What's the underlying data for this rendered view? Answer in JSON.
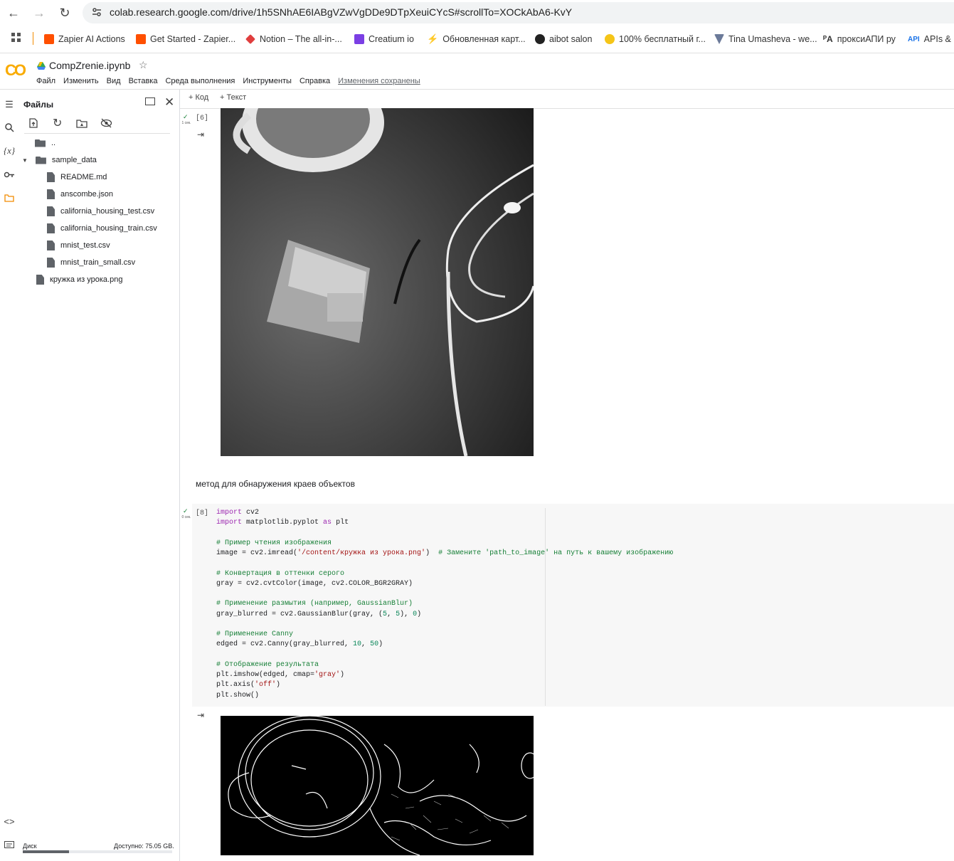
{
  "browser": {
    "url": "colab.research.google.com/drive/1h5SNhAE6IABgVZwVgDDe9DTpXeuiCYcS#scrollTo=XOCkAbA6-KvY",
    "bookmarks": [
      {
        "label": "Zapier AI Actions",
        "color": "#ff4f00"
      },
      {
        "label": "Get Started - Zapier...",
        "color": "#ff4f00"
      },
      {
        "label": "Notion – The all-in-...",
        "color": "#e03e3e"
      },
      {
        "label": "Creatium io",
        "color": "#7b3fe4"
      },
      {
        "label": "Обновленная карт...",
        "color": "#4b3fe4"
      },
      {
        "label": "aibot salon",
        "color": "#222222"
      },
      {
        "label": "100% бесплатный г...",
        "color": "#f5c518"
      },
      {
        "label": "Tina Umasheva - we...",
        "color": "#6b7a99"
      },
      {
        "label": "проксиАПИ ру",
        "color": "#333333"
      },
      {
        "label": "APIs & S",
        "color": "#1a73e8"
      }
    ]
  },
  "header": {
    "title": "CompZrenie.ipynb",
    "logo": "CO",
    "menu": [
      "Файл",
      "Изменить",
      "Вид",
      "Вставка",
      "Среда выполнения",
      "Инструменты",
      "Справка",
      "Изменения сохранены"
    ]
  },
  "sidebar": {
    "title": "Файлы",
    "parent": "..",
    "folder": "sample_data",
    "files": [
      "README.md",
      "anscombe.json",
      "california_housing_test.csv",
      "california_housing_train.csv",
      "mnist_test.csv",
      "mnist_train_small.csv"
    ],
    "root_file": "кружка из урока.png",
    "disk_label": "Диск",
    "disk_available": "Доступно: 75.05 GB.",
    "disk_used_fraction": 0.31
  },
  "toolbar": {
    "add_code": "Код",
    "add_text": "Текст"
  },
  "cells": {
    "cell1_count": "[6]",
    "cell1_time": "1 сек.",
    "text_cell": "метод для обнаружения краев объектов",
    "cell2_count": "[8]",
    "cell2_time": "0 сек.",
    "code_lines": [
      "import cv2",
      "import matplotlib.pyplot as plt",
      "",
      "# Пример чтения изображения",
      "image = cv2.imread('/content/кружка из урока.png')  # Замените 'path_to_image' на путь к вашему изображению",
      "",
      "# Конвертация в оттенки серого",
      "gray = cv2.cvtColor(image, cv2.COLOR_BGR2GRAY)",
      "",
      "# Применение размытия (например, GaussianBlur)",
      "gray_blurred = cv2.GaussianBlur(gray, (5, 5), 0)",
      "",
      "# Применение Canny",
      "edged = cv2.Canny(gray_blurred, 10, 50)",
      "",
      "# Отображение результата",
      "plt.imshow(edged, cmap='gray')",
      "plt.axis('off')",
      "plt.show()"
    ]
  }
}
